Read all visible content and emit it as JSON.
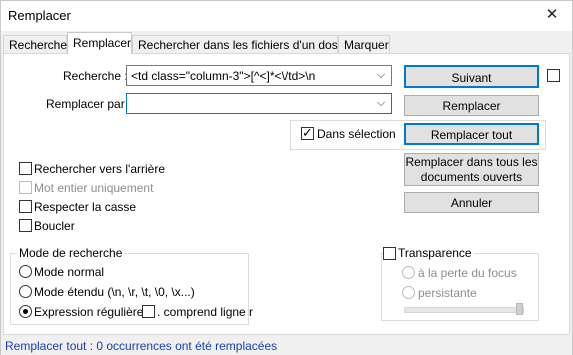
{
  "window": {
    "title": "Remplacer"
  },
  "tabs": [
    {
      "label": "Rechercher"
    },
    {
      "label": "Remplacer"
    },
    {
      "label": "Rechercher dans les fichiers d'un dossier"
    },
    {
      "label": "Marquer"
    }
  ],
  "find": {
    "label": "Recherche :",
    "value": "<td class=\"column-3\">[^<]*<\\/td>\\n"
  },
  "replace": {
    "label": "Remplacer par :",
    "value": ""
  },
  "in_selection": {
    "label": "Dans sélection",
    "checked": true
  },
  "buttons": {
    "next": "Suivant",
    "replace": "Remplacer",
    "replace_all": "Remplacer tout",
    "replace_all_docs_line1": "Remplacer dans tous les",
    "replace_all_docs_line2": "documents ouverts",
    "cancel": "Annuler"
  },
  "options": {
    "backward": "Rechercher vers l'arrière",
    "whole_word": "Mot entier uniquement",
    "match_case": "Respecter la casse",
    "wrap": "Boucler"
  },
  "search_mode": {
    "title": "Mode de recherche",
    "normal": "Mode normal",
    "extended": "Mode étendu (\\n, \\r, \\t, \\0, \\x...)",
    "regex": "Expression régulière",
    "dot_newline": ". comprend ligne r",
    "selected": "regex"
  },
  "transparency": {
    "title": "Transparence",
    "on_lose_focus": "à la perte du focus",
    "always": "persistante"
  },
  "status": "Remplacer tout : 0 occurrences ont été remplacées"
}
